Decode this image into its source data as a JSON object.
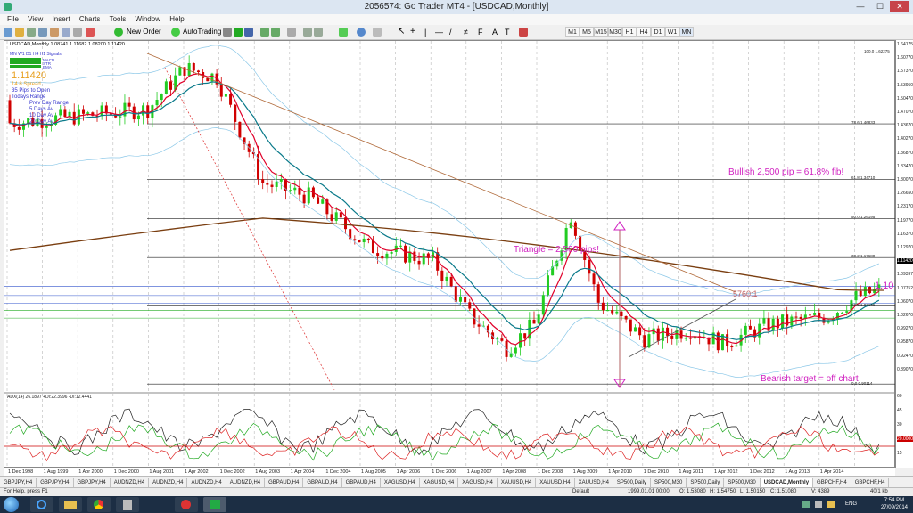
{
  "window": {
    "title": "2056574: Go Trader MT4 - [USDCAD,Monthly]",
    "minimize": "—",
    "maximize": "☐",
    "close": "✕"
  },
  "menu": [
    "File",
    "View",
    "Insert",
    "Charts",
    "Tools",
    "Window",
    "Help"
  ],
  "toolbar": {
    "new_order": "New Order",
    "auto_trading": "AutoTrading",
    "timeframes": [
      "M1",
      "M5",
      "M15",
      "M30",
      "H1",
      "H4",
      "D1",
      "W1",
      "MN"
    ]
  },
  "chart": {
    "header": "USDCAD,Monthly  1.08741 1.11682 1.08200 1.11420",
    "panel_tabs": "MN W1 D1 H4 H1 Signals",
    "panel_rows": [
      "MACD",
      "STR",
      "EMA"
    ],
    "price_big": "1.11420",
    "spread": "14.8  Spread",
    "pips_to_open": "35    Pips to Open",
    "todays_range": "        Todays Range",
    "prev_day_range": "Prev Day Range",
    "five_day_av": "5 Days Av",
    "ten_day_av": "10 Day Av",
    "twenty_day_av": "20 Day Av"
  },
  "annotations": {
    "bullish": "Bullish 2,500 pip = 61.8% fib!",
    "triangle": "Triangle = 2,500 pips!",
    "bearish": "Bearish target = off chart",
    "price_mark": "1.10",
    "ratio": "5760:1"
  },
  "fib_levels": [
    {
      "label": "100.0  1.62275",
      "price": 1.62275
    },
    {
      "label": "78.6  1.46833",
      "price": 1.46833
    },
    {
      "label": "61.8  1.34710",
      "price": 1.3471
    },
    {
      "label": "50.0  1.26195",
      "price": 1.26195
    },
    {
      "label": "38.2  1.17680",
      "price": 1.1768
    },
    {
      "label": "23.6  1.07146",
      "price": 1.07146
    },
    {
      "label": "0.0  0.90114",
      "price": 0.90114
    }
  ],
  "price_axis": [
    "1.64175",
    "1.60770",
    "1.57370",
    "1.53950",
    "1.50470",
    "1.47070",
    "1.43670",
    "1.40270",
    "1.36870",
    "1.33470",
    "1.30070",
    "1.26650",
    "1.23170",
    "1.19770",
    "1.16370",
    "1.12970",
    "1.11420",
    "1.09397",
    "1.07752",
    "1.06070",
    "1.02670",
    "0.99270",
    "0.95870",
    "0.92470",
    "0.89070"
  ],
  "indicator": {
    "title": "ADX(14) 26.1897 +DI:22.3996 -DI:12.4441",
    "axis": [
      "60",
      "45",
      "30",
      "20.0000",
      "15"
    ]
  },
  "date_axis": [
    "1 Dec 1998",
    "1 Aug 1999",
    "1 Apr 2000",
    "1 Dec 2000",
    "1 Aug 2001",
    "1 Apr 2002",
    "1 Dec 2002",
    "1 Aug 2003",
    "1 Apr 2004",
    "1 Dec 2004",
    "1 Aug 2005",
    "1 Apr 2006",
    "1 Dec 2006",
    "1 Aug 2007",
    "1 Apr 2008",
    "1 Dec 2008",
    "1 Aug 2009",
    "1 Apr 2010",
    "1 Dec 2010",
    "1 Aug 2011",
    "1 Apr 2012",
    "1 Dec 2012",
    "1 Aug 2013",
    "1 Apr 2014"
  ],
  "sheet_tabs": [
    "GBPJPY,H4",
    "GBPJPY,H4",
    "GBPJPY,H4",
    "AUDNZD,H4",
    "AUDNZD,H4",
    "AUDNZD,H4",
    "AUDNZD,H4",
    "GBPAUD,H4",
    "GBPAUD,H4",
    "GBPAUD,H4",
    "XAGUSD,H4",
    "XAGUSD,H4",
    "XAGUSD,H4",
    "XAUUSD,H4",
    "XAUUSD,H4",
    "XAUUSD,H4",
    "SP500,Daily",
    "SP500,M30",
    "SP500,Daily",
    "SP500,M30",
    "USDCAD,Monthly",
    "GBPCHF,H4",
    "GBPCHF,H4"
  ],
  "active_tab_index": 20,
  "status": {
    "help": "For Help, press F1",
    "profile": "Default",
    "datetime": "1999.01.01 00:00",
    "open": "O: 1.53080",
    "high": "H: 1.54750",
    "low": "L: 1.50150",
    "close": "C: 1.51080",
    "volume": "V: 4389",
    "traffic": "40/1 kb"
  },
  "taskbar": {
    "time": "7:54 PM",
    "date": "27/09/2014",
    "lang": "ENG"
  },
  "colors": {
    "ema_fast": "#e0002a",
    "ema_mid": "#0a7a8a",
    "ema_slow": "#7a3e10",
    "bull_candle": "#22cc22",
    "bear_candle": "#d00000",
    "annotation": "#d020c0",
    "fib_line": "#222222"
  }
}
